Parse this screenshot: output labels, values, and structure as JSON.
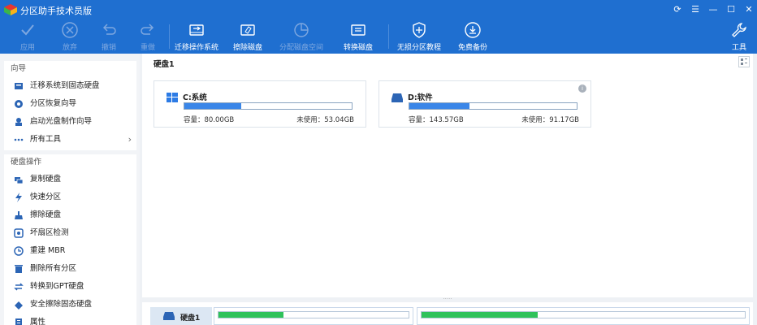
{
  "window": {
    "title": "分区助手技术员版"
  },
  "toolbar": {
    "apply": "应用",
    "discard": "放弃",
    "undo": "撤销",
    "redo": "重做",
    "migrate_os": "迁移操作系统",
    "wipe_disk": "擦除磁盘",
    "allocate_space": "分配磁盘空间",
    "convert_disk": "转换磁盘",
    "lossless_partition": "无损分区教程",
    "free_backup": "免费备份",
    "tools": "工具"
  },
  "sidebar": {
    "wizard": {
      "heading": "向导",
      "items": [
        {
          "label": "迁移系统到固态硬盘",
          "icon": "ssd-icon"
        },
        {
          "label": "分区恢复向导",
          "icon": "recovery-icon"
        },
        {
          "label": "启动光盘制作向导",
          "icon": "boot-disc-icon"
        },
        {
          "label": "所有工具",
          "icon": "more-icon"
        }
      ]
    },
    "disk_ops": {
      "heading": "硬盘操作",
      "items": [
        {
          "label": "复制硬盘",
          "icon": "copy-disk-icon"
        },
        {
          "label": "快速分区",
          "icon": "lightning-icon"
        },
        {
          "label": "擦除硬盘",
          "icon": "wipe-icon"
        },
        {
          "label": "坏扇区检测",
          "icon": "scan-icon"
        },
        {
          "label": "重建 MBR",
          "icon": "mbr-icon"
        },
        {
          "label": "删除所有分区",
          "icon": "trash-icon"
        },
        {
          "label": "转换到GPT硬盘",
          "icon": "convert-icon"
        },
        {
          "label": "安全擦除固态硬盘",
          "icon": "eraser-icon"
        },
        {
          "label": "属性",
          "icon": "properties-icon"
        }
      ]
    }
  },
  "main": {
    "disk_title": "硬盘1",
    "partitions": [
      {
        "name": "C:系统",
        "capacity": "容量：80.00GB",
        "unused": "未使用：53.04GB",
        "used_fraction": 0.34,
        "icon": "windows-icon"
      },
      {
        "name": "D:软件",
        "capacity": "容量：143.57GB",
        "unused": "未使用：91.17GB",
        "used_fraction": 0.36,
        "icon": "drive-icon"
      }
    ],
    "bottom": {
      "disk_label": "硬盘1",
      "segments": [
        {
          "used_fraction": 0.34
        },
        {
          "used_fraction": 0.36
        }
      ]
    }
  },
  "colors": {
    "titlebar": "#1f6fd0",
    "accent_bar": "#3a86e8",
    "usage_green": "#2fc25b"
  }
}
